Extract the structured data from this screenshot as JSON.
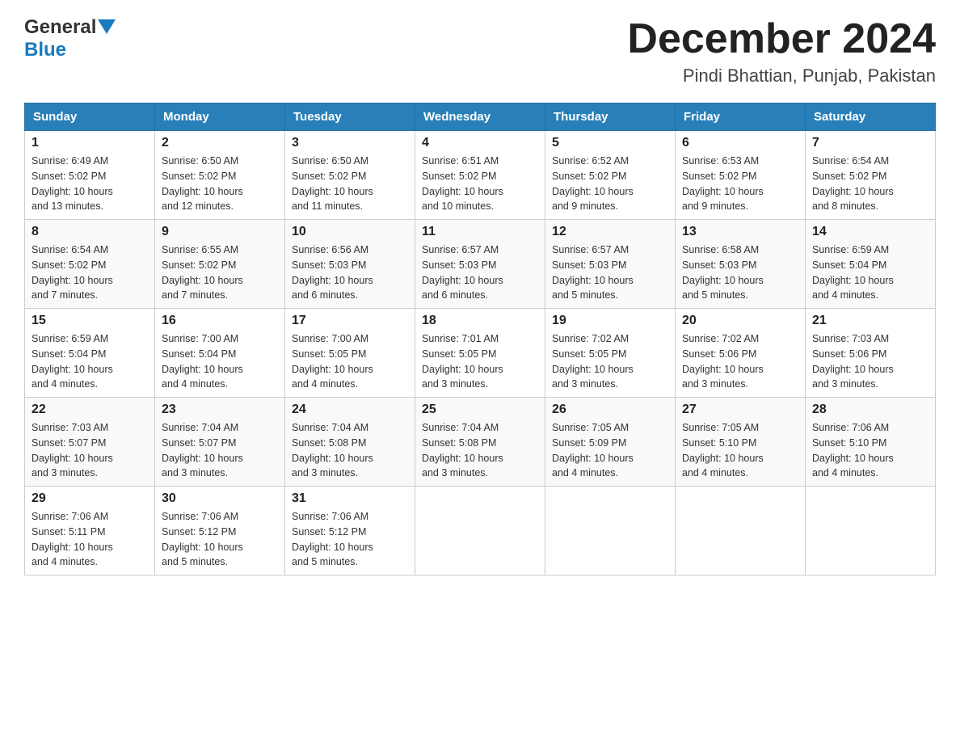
{
  "header": {
    "logo_general": "General",
    "logo_blue": "Blue",
    "month_title": "December 2024",
    "location": "Pindi Bhattian, Punjab, Pakistan"
  },
  "weekdays": [
    "Sunday",
    "Monday",
    "Tuesday",
    "Wednesday",
    "Thursday",
    "Friday",
    "Saturday"
  ],
  "weeks": [
    [
      {
        "day": "1",
        "sunrise": "6:49 AM",
        "sunset": "5:02 PM",
        "daylight": "10 hours and 13 minutes."
      },
      {
        "day": "2",
        "sunrise": "6:50 AM",
        "sunset": "5:02 PM",
        "daylight": "10 hours and 12 minutes."
      },
      {
        "day": "3",
        "sunrise": "6:50 AM",
        "sunset": "5:02 PM",
        "daylight": "10 hours and 11 minutes."
      },
      {
        "day": "4",
        "sunrise": "6:51 AM",
        "sunset": "5:02 PM",
        "daylight": "10 hours and 10 minutes."
      },
      {
        "day": "5",
        "sunrise": "6:52 AM",
        "sunset": "5:02 PM",
        "daylight": "10 hours and 9 minutes."
      },
      {
        "day": "6",
        "sunrise": "6:53 AM",
        "sunset": "5:02 PM",
        "daylight": "10 hours and 9 minutes."
      },
      {
        "day": "7",
        "sunrise": "6:54 AM",
        "sunset": "5:02 PM",
        "daylight": "10 hours and 8 minutes."
      }
    ],
    [
      {
        "day": "8",
        "sunrise": "6:54 AM",
        "sunset": "5:02 PM",
        "daylight": "10 hours and 7 minutes."
      },
      {
        "day": "9",
        "sunrise": "6:55 AM",
        "sunset": "5:02 PM",
        "daylight": "10 hours and 7 minutes."
      },
      {
        "day": "10",
        "sunrise": "6:56 AM",
        "sunset": "5:03 PM",
        "daylight": "10 hours and 6 minutes."
      },
      {
        "day": "11",
        "sunrise": "6:57 AM",
        "sunset": "5:03 PM",
        "daylight": "10 hours and 6 minutes."
      },
      {
        "day": "12",
        "sunrise": "6:57 AM",
        "sunset": "5:03 PM",
        "daylight": "10 hours and 5 minutes."
      },
      {
        "day": "13",
        "sunrise": "6:58 AM",
        "sunset": "5:03 PM",
        "daylight": "10 hours and 5 minutes."
      },
      {
        "day": "14",
        "sunrise": "6:59 AM",
        "sunset": "5:04 PM",
        "daylight": "10 hours and 4 minutes."
      }
    ],
    [
      {
        "day": "15",
        "sunrise": "6:59 AM",
        "sunset": "5:04 PM",
        "daylight": "10 hours and 4 minutes."
      },
      {
        "day": "16",
        "sunrise": "7:00 AM",
        "sunset": "5:04 PM",
        "daylight": "10 hours and 4 minutes."
      },
      {
        "day": "17",
        "sunrise": "7:00 AM",
        "sunset": "5:05 PM",
        "daylight": "10 hours and 4 minutes."
      },
      {
        "day": "18",
        "sunrise": "7:01 AM",
        "sunset": "5:05 PM",
        "daylight": "10 hours and 3 minutes."
      },
      {
        "day": "19",
        "sunrise": "7:02 AM",
        "sunset": "5:05 PM",
        "daylight": "10 hours and 3 minutes."
      },
      {
        "day": "20",
        "sunrise": "7:02 AM",
        "sunset": "5:06 PM",
        "daylight": "10 hours and 3 minutes."
      },
      {
        "day": "21",
        "sunrise": "7:03 AM",
        "sunset": "5:06 PM",
        "daylight": "10 hours and 3 minutes."
      }
    ],
    [
      {
        "day": "22",
        "sunrise": "7:03 AM",
        "sunset": "5:07 PM",
        "daylight": "10 hours and 3 minutes."
      },
      {
        "day": "23",
        "sunrise": "7:04 AM",
        "sunset": "5:07 PM",
        "daylight": "10 hours and 3 minutes."
      },
      {
        "day": "24",
        "sunrise": "7:04 AM",
        "sunset": "5:08 PM",
        "daylight": "10 hours and 3 minutes."
      },
      {
        "day": "25",
        "sunrise": "7:04 AM",
        "sunset": "5:08 PM",
        "daylight": "10 hours and 3 minutes."
      },
      {
        "day": "26",
        "sunrise": "7:05 AM",
        "sunset": "5:09 PM",
        "daylight": "10 hours and 4 minutes."
      },
      {
        "day": "27",
        "sunrise": "7:05 AM",
        "sunset": "5:10 PM",
        "daylight": "10 hours and 4 minutes."
      },
      {
        "day": "28",
        "sunrise": "7:06 AM",
        "sunset": "5:10 PM",
        "daylight": "10 hours and 4 minutes."
      }
    ],
    [
      {
        "day": "29",
        "sunrise": "7:06 AM",
        "sunset": "5:11 PM",
        "daylight": "10 hours and 4 minutes."
      },
      {
        "day": "30",
        "sunrise": "7:06 AM",
        "sunset": "5:12 PM",
        "daylight": "10 hours and 5 minutes."
      },
      {
        "day": "31",
        "sunrise": "7:06 AM",
        "sunset": "5:12 PM",
        "daylight": "10 hours and 5 minutes."
      },
      null,
      null,
      null,
      null
    ]
  ],
  "labels": {
    "sunrise": "Sunrise:",
    "sunset": "Sunset:",
    "daylight": "Daylight:"
  }
}
